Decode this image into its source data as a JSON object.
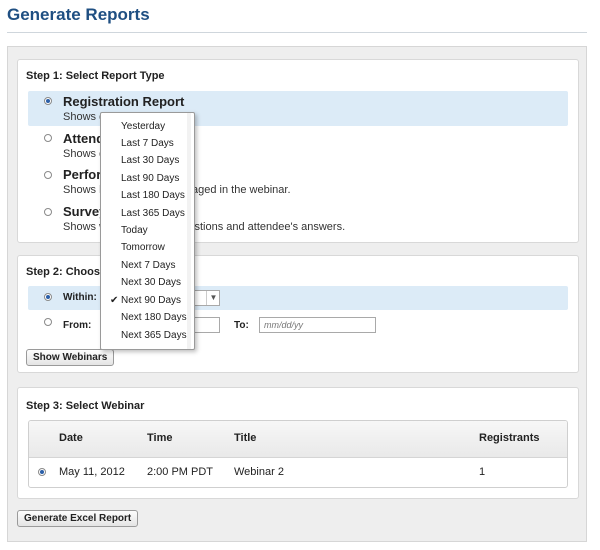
{
  "page": {
    "title": "Generate Reports"
  },
  "step1": {
    "title": "Step 1: Select Report Type",
    "options": [
      {
        "title": "Registration Report",
        "desc": "Shows detailed registrants.",
        "selected": true
      },
      {
        "title": "Attendee Report",
        "desc": "Shows detailed attendees.",
        "selected": false
      },
      {
        "title": "Performance Report",
        "desc": "Shows how attendees engaged in the webinar.",
        "selected": false
      },
      {
        "title": "Survey Report",
        "desc": "Shows webinar survey questions and attendee's answers.",
        "selected": false
      }
    ]
  },
  "step2": {
    "title": "Step 2: Choose Date Range",
    "within_label": "Within:",
    "from_label": "From:",
    "to_label": "To:",
    "to_placeholder": "mm/dd/yy",
    "show_button": "Show Webinars",
    "dropdown": {
      "options": [
        "Yesterday",
        "Last 7 Days",
        "Last 30 Days",
        "Last 90 Days",
        "Last 180 Days",
        "Last 365 Days",
        "Today",
        "Tomorrow",
        "Next 7 Days",
        "Next 30 Days",
        "Next 90 Days",
        "Next 180 Days",
        "Next 365 Days"
      ],
      "selected_index": 10
    }
  },
  "step3": {
    "title": "Step 3: Select Webinar",
    "columns": [
      "Date",
      "Time",
      "Title",
      "Registrants"
    ],
    "rows": [
      {
        "date": "May 11, 2012",
        "time": "2:00 PM PDT",
        "title": "Webinar 2",
        "registrants": "1",
        "selected": true
      }
    ]
  },
  "footer": {
    "generate_button": "Generate Excel Report"
  }
}
